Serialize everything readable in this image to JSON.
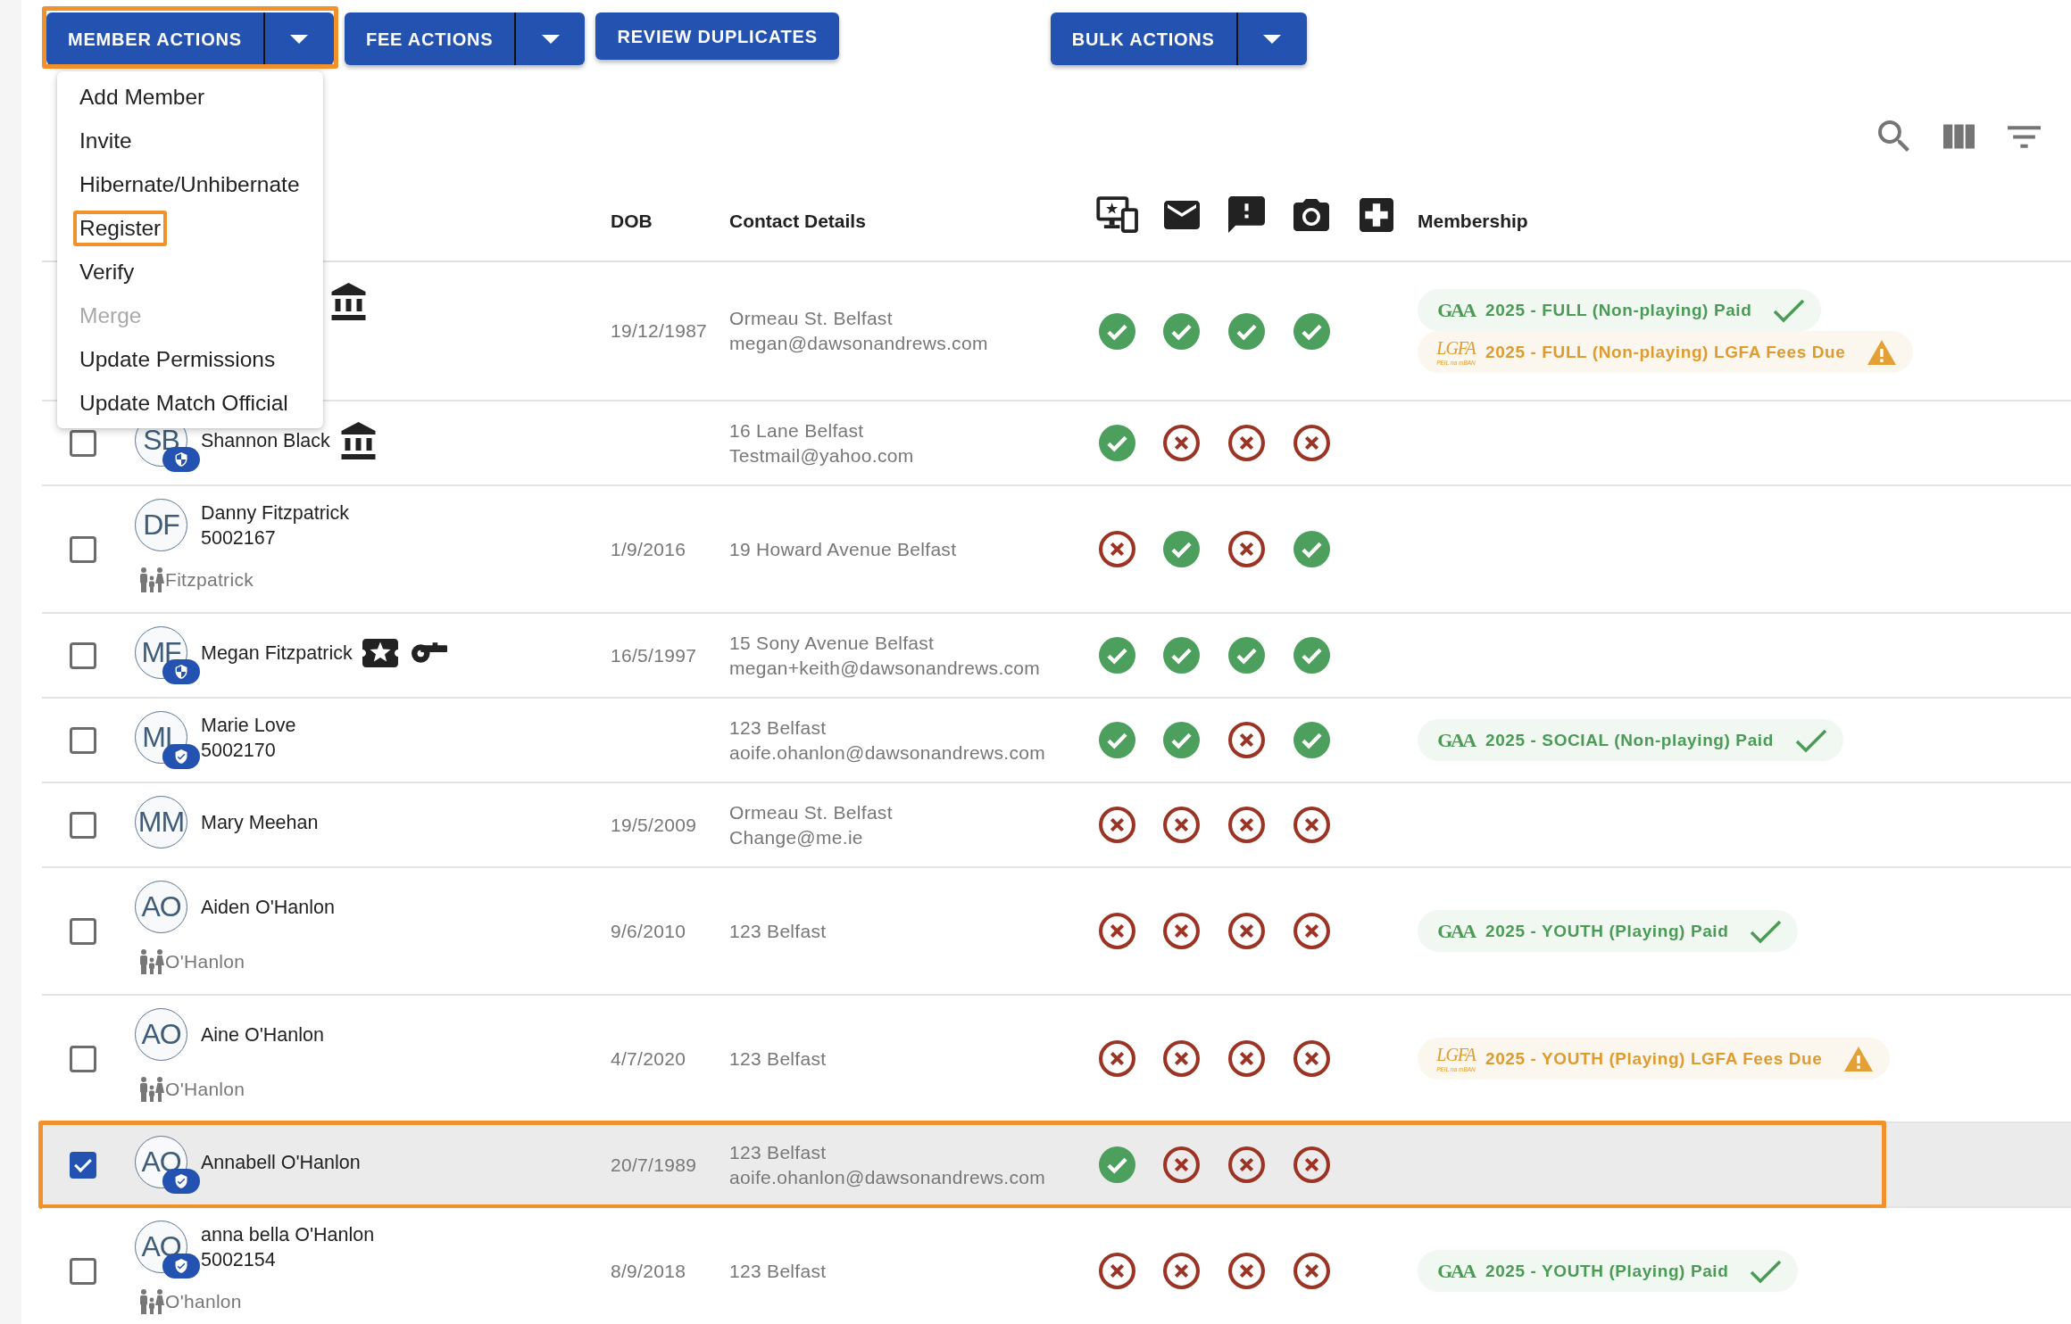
{
  "toolbar": {
    "buttons": [
      {
        "label": "MEMBER ACTIONS",
        "kind": "split",
        "highlighted": true
      },
      {
        "label": "FEE ACTIONS",
        "kind": "split",
        "highlighted": false
      },
      {
        "label": "REVIEW DUPLICATES",
        "kind": "plain",
        "highlighted": false
      },
      {
        "label": "BULK ACTIONS",
        "kind": "split",
        "highlighted": false
      }
    ]
  },
  "menu": {
    "items": [
      {
        "label": "Add Member",
        "disabled": false,
        "highlighted": false
      },
      {
        "label": "Invite",
        "disabled": false,
        "highlighted": false
      },
      {
        "label": "Hibernate/Unhibernate",
        "disabled": false,
        "highlighted": false
      },
      {
        "label": "Register",
        "disabled": false,
        "highlighted": true
      },
      {
        "label": "Verify",
        "disabled": false,
        "highlighted": false
      },
      {
        "label": "Merge",
        "disabled": true,
        "highlighted": false
      },
      {
        "label": "Update Permissions",
        "disabled": false,
        "highlighted": false
      },
      {
        "label": "Update Match Official",
        "disabled": false,
        "highlighted": false
      }
    ]
  },
  "table": {
    "columns": [
      "DOB",
      "Contact Details",
      "Membership"
    ],
    "rows": [
      {
        "selected": false,
        "highlighted": false,
        "badges": [
          {
            "kind": "club"
          }
        ],
        "dob": "19/12/1987",
        "address": "Ormeau St. Belfast",
        "email": "megan@dawsonandrews.com",
        "checks": [
          {
            "ok": true
          },
          {
            "ok": true
          },
          {
            "ok": true
          },
          {
            "ok": true
          }
        ],
        "memberships": [
          {
            "org": {
              "kind": "gaa",
              "text": "GAA"
            },
            "label": "2025 - FULL (Non-playing) Paid",
            "kind": "paid"
          },
          {
            "org": {
              "kind": "lgfa",
              "text": "LGFA",
              "tagline": "PEIL na mBAN"
            },
            "label": "2025 - FULL (Non-playing) LGFA Fees Due",
            "kind": "due"
          }
        ]
      },
      {
        "selected": false,
        "highlighted": false,
        "initials": "SB",
        "avatar_badge": {
          "kind": "shield"
        },
        "name": "Shannon Black",
        "badges": [
          {
            "kind": "club"
          }
        ],
        "address": "16 Lane Belfast",
        "email": "Testmail@yahoo.com",
        "checks": [
          {
            "ok": true
          },
          {
            "ok": false
          },
          {
            "ok": false
          },
          {
            "ok": false
          }
        ]
      },
      {
        "selected": false,
        "highlighted": false,
        "initials": "DF",
        "name": "Danny Fitzpatrick",
        "member_id": "5002167",
        "family": "Fitzpatrick",
        "dob": "1/9/2016",
        "address": "19 Howard Avenue Belfast",
        "checks": [
          {
            "ok": false
          },
          {
            "ok": true
          },
          {
            "ok": false
          },
          {
            "ok": true
          }
        ]
      },
      {
        "selected": false,
        "highlighted": false,
        "initials": "MF",
        "avatar_badge": {
          "kind": "shield"
        },
        "name": "Megan Fitzpatrick",
        "badges": [
          {
            "kind": "ticket"
          },
          {
            "kind": "whistle"
          }
        ],
        "dob": "16/5/1997",
        "address": "15 Sony Avenue Belfast",
        "email": "megan+keith@dawsonandrews.com",
        "checks": [
          {
            "ok": true
          },
          {
            "ok": true
          },
          {
            "ok": true
          },
          {
            "ok": true
          }
        ]
      },
      {
        "selected": false,
        "highlighted": false,
        "initials": "ML",
        "avatar_badge": {
          "kind": "verified"
        },
        "name": "Marie Love",
        "member_id": "5002170",
        "address": "123 Belfast",
        "email": "aoife.ohanlon@dawsonandrews.com",
        "checks": [
          {
            "ok": true
          },
          {
            "ok": true
          },
          {
            "ok": false
          },
          {
            "ok": true
          }
        ],
        "memberships": [
          {
            "org": {
              "kind": "gaa",
              "text": "GAA"
            },
            "label": "2025 - SOCIAL (Non-playing) Paid",
            "kind": "paid"
          }
        ]
      },
      {
        "selected": false,
        "highlighted": false,
        "initials": "MM",
        "name": "Mary Meehan",
        "dob": "19/5/2009",
        "address": "Ormeau St. Belfast",
        "email": "Change@me.ie",
        "checks": [
          {
            "ok": false
          },
          {
            "ok": false
          },
          {
            "ok": false
          },
          {
            "ok": false
          }
        ]
      },
      {
        "selected": false,
        "highlighted": false,
        "initials": "AO",
        "name": "Aiden O'Hanlon",
        "family": "O'Hanlon",
        "dob": "9/6/2010",
        "address": "123 Belfast",
        "checks": [
          {
            "ok": false
          },
          {
            "ok": false
          },
          {
            "ok": false
          },
          {
            "ok": false
          }
        ],
        "memberships": [
          {
            "org": {
              "kind": "gaa",
              "text": "GAA"
            },
            "label": "2025 - YOUTH (Playing) Paid",
            "kind": "paid"
          }
        ]
      },
      {
        "selected": false,
        "highlighted": false,
        "initials": "AO",
        "name": "Aine O'Hanlon",
        "family": "O'Hanlon",
        "dob": "4/7/2020",
        "address": "123 Belfast",
        "checks": [
          {
            "ok": false
          },
          {
            "ok": false
          },
          {
            "ok": false
          },
          {
            "ok": false
          }
        ],
        "memberships": [
          {
            "org": {
              "kind": "lgfa",
              "text": "LGFA",
              "tagline": "PEIL na mBAN"
            },
            "label": "2025 - YOUTH (Playing) LGFA Fees Due",
            "kind": "due"
          }
        ]
      },
      {
        "selected": true,
        "highlighted": true,
        "initials": "AO",
        "avatar_badge": {
          "kind": "verified"
        },
        "name": "Annabell O'Hanlon",
        "dob": "20/7/1989",
        "address": "123 Belfast",
        "email": "aoife.ohanlon@dawsonandrews.com",
        "checks": [
          {
            "ok": true
          },
          {
            "ok": false
          },
          {
            "ok": false
          },
          {
            "ok": false
          }
        ]
      },
      {
        "selected": false,
        "highlighted": false,
        "initials": "AO",
        "avatar_badge": {
          "kind": "verified"
        },
        "name": "anna bella O'Hanlon",
        "member_id": "5002154",
        "family": "O'hanlon",
        "dob": "8/9/2018",
        "address": "123 Belfast",
        "checks": [
          {
            "ok": false
          },
          {
            "ok": false
          },
          {
            "ok": false
          },
          {
            "ok": false
          }
        ],
        "memberships": [
          {
            "org": {
              "kind": "gaa",
              "text": "GAA"
            },
            "label": "2025 - YOUTH (Playing) Paid",
            "kind": "paid"
          }
        ]
      }
    ]
  }
}
